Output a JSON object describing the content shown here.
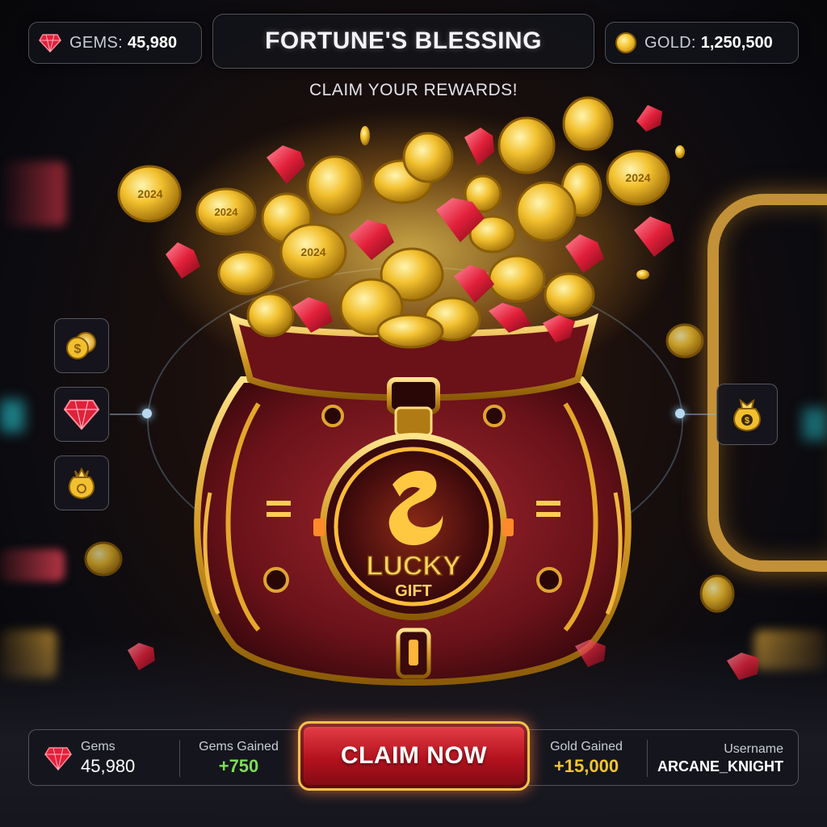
{
  "header": {
    "gems_label": "GEMS:",
    "gems_value": "45,980",
    "title": "FORTUNE'S BLESSING",
    "gold_label": "GOLD:",
    "gold_value": "1,250,500",
    "subtitle": "CLAIM YOUR REWARDS!"
  },
  "side_left": [
    {
      "icon": "coins-icon"
    },
    {
      "icon": "gem-icon"
    },
    {
      "icon": "gift-pouch-icon"
    }
  ],
  "side_right": [
    {
      "icon": "money-bag-icon"
    }
  ],
  "bag": {
    "emblem_title": "LUCKY",
    "emblem_subtitle": "GIFT",
    "emblem_icon": "dragon-icon"
  },
  "coin_engraving": "2024",
  "footer": {
    "gems_label": "Gems",
    "gems_value": "45,980",
    "gems_gained_label": "Gems Gained",
    "gems_gained_value": "+750",
    "claim_label": "CLAIM NOW",
    "gold_gained_label": "Gold Gained",
    "gold_gained_value": "+15,000",
    "username_label": "Username",
    "username_value": "ARCANE_KNIGHT"
  },
  "colors": {
    "gem": "#e2203a",
    "gold": "#f5c431",
    "gained_green": "#7ddc5a",
    "gained_gold": "#f5c431",
    "claim_red": "#c8182a"
  }
}
